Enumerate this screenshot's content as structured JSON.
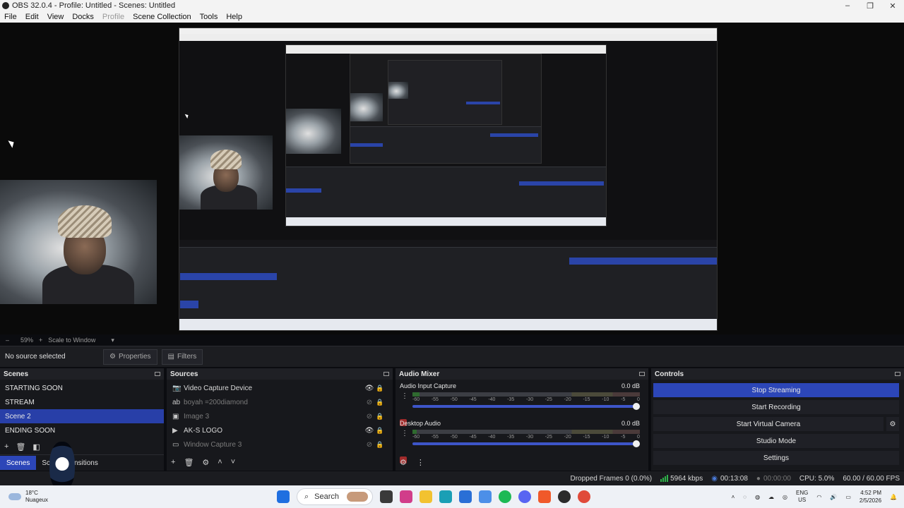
{
  "window": {
    "title": "OBS 32.0.4 - Profile: Untitled - Scenes: Untitled",
    "controls": [
      "–",
      "❐",
      "✕"
    ]
  },
  "menu": {
    "items": [
      "File",
      "Edit",
      "View",
      "Docks",
      "Profile",
      "Scene Collection",
      "Tools",
      "Help"
    ]
  },
  "preview": {
    "zoom_minus": "–",
    "zoom": "59%",
    "zoom_plus": "+",
    "scale_mode": "Scale to Window"
  },
  "context_bar": {
    "no_source": "No source selected",
    "properties": "Properties",
    "filters": "Filters"
  },
  "scenes": {
    "title": "Scenes",
    "items": [
      "STARTING SOON",
      "STREAM",
      "Scene 2",
      "ENDING SOON"
    ],
    "selected_index": 2,
    "tab_scenes": "Scenes",
    "tab_transitions": "Scene Transitions"
  },
  "sources": {
    "title": "Sources",
    "items": [
      {
        "name": "Video Capture Device",
        "icon": "camera-icon",
        "visible": true
      },
      {
        "name": "boyah =200diamond",
        "icon": "text-icon",
        "visible": false
      },
      {
        "name": "Image 3",
        "icon": "image-icon",
        "visible": false
      },
      {
        "name": "AK-S LOGO",
        "icon": "media-icon",
        "visible": true
      },
      {
        "name": "Window Capture 3",
        "icon": "window-icon",
        "visible": false
      }
    ]
  },
  "mixer": {
    "title": "Audio Mixer",
    "channels": [
      {
        "name": "Audio Input Capture",
        "db": "0.0 dB",
        "level": 0.03
      },
      {
        "name": "Desktop Audio",
        "db": "0.0 dB",
        "level": 0.02
      }
    ],
    "scale": [
      "-60",
      "-55",
      "-50",
      "-45",
      "-40",
      "-35",
      "-30",
      "-25",
      "-20",
      "-15",
      "-10",
      "-5",
      "0"
    ]
  },
  "controls": {
    "title": "Controls",
    "stop_streaming": "Stop Streaming",
    "start_recording": "Start Recording",
    "start_virtual_camera": "Start Virtual Camera",
    "studio_mode": "Studio Mode",
    "settings": "Settings",
    "accent": "#2c46b8"
  },
  "status": {
    "dropped_frames": "Dropped Frames 0 (0.0%)",
    "bitrate": "5964 kbps",
    "stream_time": "00:13:08",
    "record_time": "00:00:00",
    "cpu": "CPU: 5.0%",
    "fps": "60.00 / 60.00 FPS"
  },
  "taskbar": {
    "weather_temp": "18°C",
    "weather_desc": "Nuageux",
    "search": "Search",
    "lang_top": "ENG",
    "lang_bottom": "US",
    "time": "4:52 PM",
    "date": "2/5/2026"
  }
}
